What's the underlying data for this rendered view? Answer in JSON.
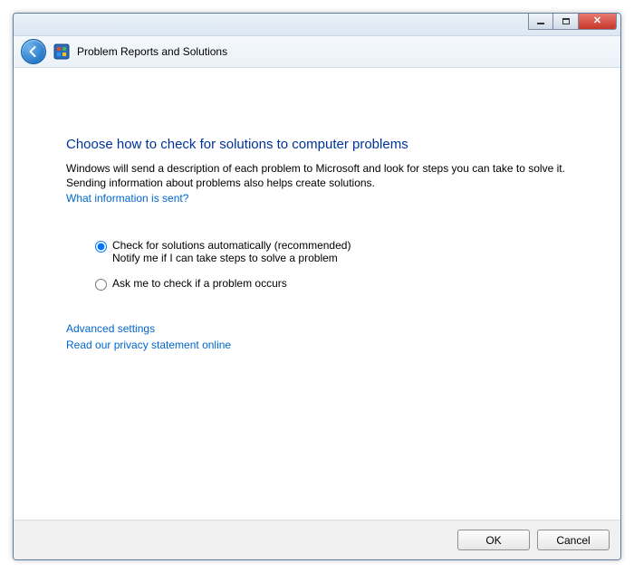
{
  "breadcrumb": {
    "title": "Problem Reports and Solutions"
  },
  "main": {
    "heading": "Choose how to check for solutions to computer problems",
    "description": "Windows will send a description of each problem to Microsoft and look for steps you can take to solve it. Sending information about problems also helps create solutions.",
    "info_link": "What information is sent?"
  },
  "options": {
    "selected": "auto",
    "auto": {
      "label": "Check for solutions automatically (recommended)",
      "sub": "Notify me if I can take steps to solve a problem"
    },
    "ask": {
      "label": "Ask me to check if a problem occurs"
    }
  },
  "links": {
    "advanced": "Advanced settings",
    "privacy": "Read our privacy statement online"
  },
  "buttons": {
    "ok": "OK",
    "cancel": "Cancel"
  }
}
